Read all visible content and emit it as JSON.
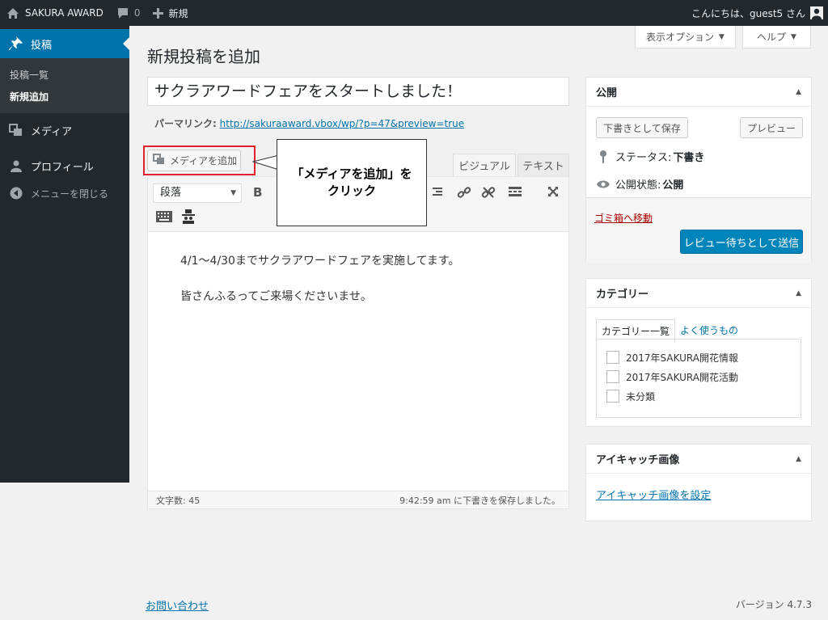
{
  "adminbar": {
    "site_name": "SAKURA AWARD",
    "comments_count": "0",
    "new_label": "新規",
    "greeting": "こんにちは、guest5 さん"
  },
  "sidebar": {
    "posts_label": "投稿",
    "submenu": [
      "投稿一覧",
      "新規追加"
    ],
    "media_label": "メディア",
    "profile_label": "プロフィール",
    "collapse_label": "メニューを閉じる"
  },
  "screen_options_label": "表示オプション",
  "help_label": "ヘルプ",
  "page_title": "新規投稿を追加",
  "post_title": "サクラアワードフェアをスタートしました！",
  "permalink": {
    "label": "パーマリンク:",
    "url": "http://sakuraaward.vbox/wp/?p=47&preview=true"
  },
  "editor": {
    "add_media_label": "メディアを追加",
    "tab_visual": "ビジュアル",
    "tab_text": "テキスト",
    "format_value": "段落",
    "content": [
      "4/1～4/30までサクラアワードフェアを実施してます。",
      "皆さんふるってご来場くださいませ。"
    ],
    "word_count": "文字数: 45",
    "save_status": "9:42:59 am に下書きを保存しました。"
  },
  "callout_text": "「メディアを追加」をクリック",
  "publish_box": {
    "title": "公開",
    "save_draft": "下書きとして保存",
    "preview": "プレビュー",
    "status_label": "ステータス:",
    "status_value": "下書き",
    "visibility_label": "公開状態:",
    "visibility_value": "公開",
    "trash_link": "ゴミ箱へ移動",
    "submit_review": "レビュー待ちとして送信"
  },
  "category_box": {
    "title": "カテゴリー",
    "tab_all": "カテゴリー一覧",
    "tab_popular": "よく使うもの",
    "items": [
      "2017年SAKURA開花情報",
      "2017年SAKURA開花活動",
      "未分類"
    ]
  },
  "thumbnail_box": {
    "title": "アイキャッチ画像",
    "set_link": "アイキャッチ画像を設定"
  },
  "footer": {
    "contact": "お問い合わせ",
    "version": "バージョン 4.7.3"
  },
  "colors": {
    "admin_dark": "#23282d",
    "accent_blue": "#0073aa",
    "primary_button": "#0085ba",
    "highlight_red": "#e0202b",
    "trash_red": "#a00"
  }
}
